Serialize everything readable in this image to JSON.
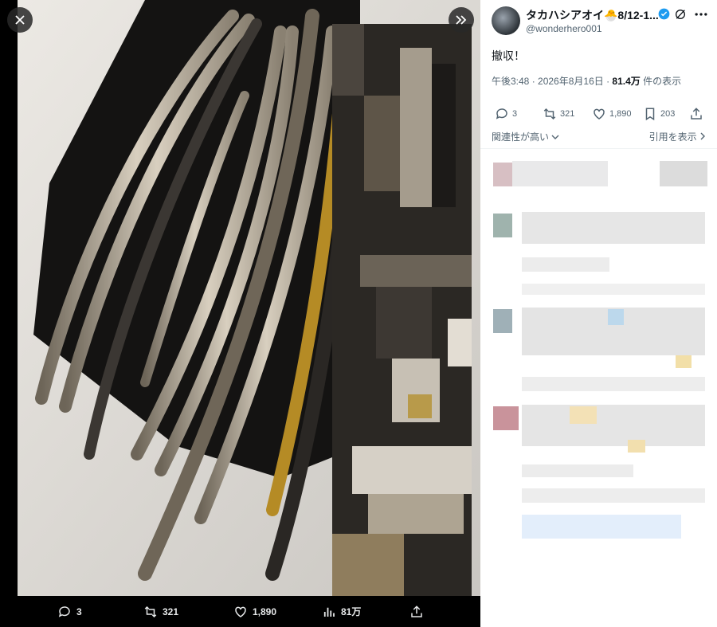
{
  "viewer": {
    "close_icon": "close-icon",
    "next_icon": "double-chevron-right-icon",
    "bottom_bar": {
      "replies": "3",
      "retweets": "321",
      "likes": "1,890",
      "views": "81万"
    }
  },
  "tweet": {
    "display_name": "タカハシアオイ🐣8/12-1...",
    "handle": "@wonderhero001",
    "text": "撤収！",
    "time": "午後3:48",
    "date": "2026年8月16日",
    "views_count": "81.4万",
    "views_suffix": " 件の表示",
    "separator": " · ",
    "stats": {
      "replies": "3",
      "retweets": "321",
      "likes": "1,890",
      "bookmarks": "203"
    },
    "sort_label": "関連性が高い",
    "quotes_label": "引用を表示"
  },
  "colors": {
    "verified": "#1d9bf0",
    "secondary_text": "#536471",
    "primary_text": "#0f1419"
  }
}
